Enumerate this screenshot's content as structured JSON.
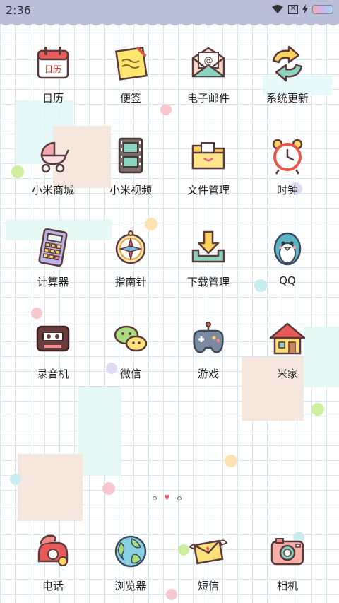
{
  "status": {
    "time": "2:36",
    "sim_label": "✕"
  },
  "apps": [
    {
      "label": "日历",
      "icon": "calendar-icon"
    },
    {
      "label": "便签",
      "icon": "notes-icon"
    },
    {
      "label": "电子邮件",
      "icon": "email-icon"
    },
    {
      "label": "系统更新",
      "icon": "update-icon"
    },
    {
      "label": "小米商城",
      "icon": "stroller-icon"
    },
    {
      "label": "小米视频",
      "icon": "film-icon"
    },
    {
      "label": "文件管理",
      "icon": "folder-icon"
    },
    {
      "label": "时钟",
      "icon": "alarm-clock-icon"
    },
    {
      "label": "计算器",
      "icon": "calculator-icon"
    },
    {
      "label": "指南针",
      "icon": "compass-icon"
    },
    {
      "label": "下载管理",
      "icon": "download-icon"
    },
    {
      "label": "QQ",
      "icon": "penguin-icon"
    },
    {
      "label": "录音机",
      "icon": "cassette-icon"
    },
    {
      "label": "微信",
      "icon": "chat-bubbles-icon"
    },
    {
      "label": "游戏",
      "icon": "gamepad-icon"
    },
    {
      "label": "米家",
      "icon": "house-icon"
    }
  ],
  "dock": [
    {
      "label": "电话",
      "icon": "phone-icon"
    },
    {
      "label": "浏览器",
      "icon": "globe-icon"
    },
    {
      "label": "短信",
      "icon": "love-letter-icon"
    },
    {
      "label": "相机",
      "icon": "camera-icon"
    }
  ],
  "pager": {
    "current": 2,
    "total": 3
  }
}
